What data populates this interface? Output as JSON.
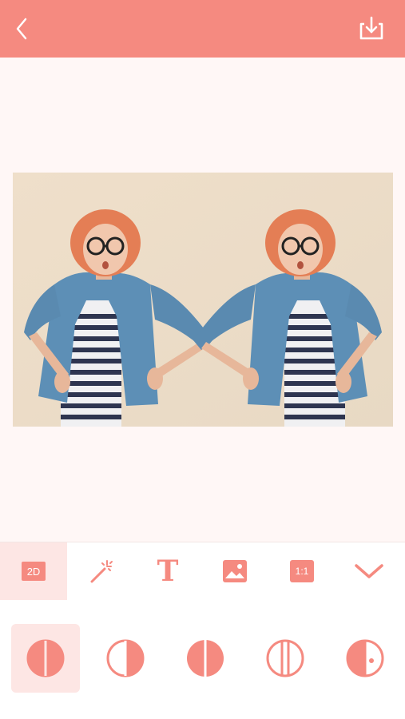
{
  "colors": {
    "accent": "#f58a80",
    "accent_light": "#fde6e4",
    "background": "#fff7f6"
  },
  "header": {
    "back_icon": "chevron-left-icon",
    "download_icon": "download-icon"
  },
  "toolbar": {
    "items": [
      {
        "id": "2d",
        "label": "2D",
        "icon": "2d-icon",
        "active": true
      },
      {
        "id": "effects",
        "label": "",
        "icon": "magic-wand-icon",
        "active": false
      },
      {
        "id": "text",
        "label": "T",
        "icon": "text-icon",
        "active": false
      },
      {
        "id": "background",
        "label": "",
        "icon": "image-icon",
        "active": false
      },
      {
        "id": "ratio",
        "label": "1:1",
        "icon": "aspect-ratio-icon",
        "active": false
      },
      {
        "id": "collapse",
        "label": "",
        "icon": "chevron-down-icon",
        "active": false
      }
    ]
  },
  "mirror_options": [
    {
      "id": "left-right",
      "icon": "mirror-left-fill-icon",
      "selected": true
    },
    {
      "id": "right-left",
      "icon": "mirror-right-fill-icon",
      "selected": false
    },
    {
      "id": "split",
      "icon": "mirror-split-icon",
      "selected": false
    },
    {
      "id": "outline",
      "icon": "mirror-outline-icon",
      "selected": false
    },
    {
      "id": "dot",
      "icon": "mirror-dot-icon",
      "selected": false
    }
  ]
}
